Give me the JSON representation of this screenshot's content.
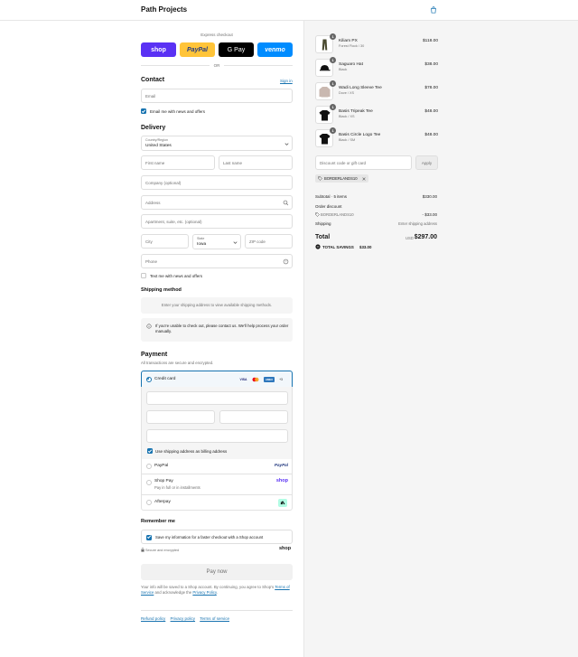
{
  "header": {
    "brand": "Path Projects",
    "cart_icon": "shopping-bag-icon"
  },
  "express": {
    "label": "Express checkout",
    "buttons": [
      {
        "label": "shop",
        "color": "#5a31f4"
      },
      {
        "label": "PayPal",
        "color": "#ffc439"
      },
      {
        "label": "G Pay",
        "color": "#000000"
      },
      {
        "label": "venmo",
        "color": "#008cff"
      }
    ],
    "or": "OR"
  },
  "contact": {
    "title": "Contact",
    "sign_in": "Sign in",
    "email_placeholder": "Email",
    "newsletter_label": "Email me with news and offers",
    "newsletter_checked": true
  },
  "delivery": {
    "title": "Delivery",
    "country_label": "Country/Region",
    "country_value": "United States",
    "first_name": "First name",
    "last_name": "Last name",
    "company": "Company (optional)",
    "address": "Address",
    "apartment": "Apartment, suite, etc. (optional)",
    "city": "City",
    "state_label": "State",
    "state_value": "Iowa",
    "zip": "ZIP code",
    "phone": "Phone",
    "text_label": "Text me with news and offers",
    "text_checked": false
  },
  "shipping": {
    "title": "Shipping method",
    "placeholder": "Enter your shipping address to view available shipping methods.",
    "notice": "If you're unable to check out, please contact us. We'll help process your order manually."
  },
  "payment": {
    "title": "Payment",
    "subtitle": "All transactions are secure and encrypted.",
    "credit_card_label": "Credit card",
    "card_brands": [
      "VISA",
      "MC",
      "AMEX",
      "+3"
    ],
    "billing_label": "Use shipping address as billing address",
    "billing_checked": true,
    "options": [
      {
        "label": "PayPal",
        "sub": "",
        "badge": "PayPal"
      },
      {
        "label": "Shop Pay",
        "sub": "Pay in full or in installments",
        "badge": "shop"
      },
      {
        "label": "Afterpay",
        "sub": "",
        "badge": "afterpay"
      }
    ],
    "accent": "#1773b0"
  },
  "remember": {
    "title": "Remember me",
    "save_label": "Save my information for a faster checkout with a Shop account",
    "save_checked": true,
    "secure": "Secure and encrypted",
    "shop_logo": "shop"
  },
  "pay_now": "Pay now",
  "legal": {
    "text_before": "Your info will be saved to a Shop account. By continuing, you agree to Shop's ",
    "terms": "Terms of Service",
    "middle": " and acknowledge the ",
    "privacy": "Privacy Policy",
    "end": "."
  },
  "footer": [
    "Refund policy",
    "Privacy policy",
    "Terms of service"
  ],
  "cart": {
    "items": [
      {
        "name": "Kiliam PX",
        "variant": "Forest Flock / 30",
        "price": "$118.00",
        "qty": "1",
        "kind": "pants"
      },
      {
        "name": "Saguaro Hat",
        "variant": "Black",
        "price": "$38.00",
        "qty": "1",
        "kind": "hat"
      },
      {
        "name": "Wadi Long Sleeve Tee",
        "variant": "Dove / XS",
        "price": "$78.00",
        "qty": "1",
        "kind": "longsleeve"
      },
      {
        "name": "Basis Tripeak Tee",
        "variant": "Black / XS",
        "price": "$48.00",
        "qty": "1",
        "kind": "tee"
      },
      {
        "name": "Basis Circle Logo Tee",
        "variant": "Black / SM",
        "price": "$48.00",
        "qty": "1",
        "kind": "tee"
      }
    ],
    "discount_placeholder": "Discount code or gift card",
    "apply": "Apply",
    "code": "BORDERLANDS10",
    "subtotal_label": "Subtotal · 5 items",
    "subtotal": "$330.00",
    "order_discount_label": "Order discount",
    "order_discount_code": "BORDERLANDS10",
    "order_discount": "- $33.00",
    "shipping_label": "Shipping",
    "shipping_value": "Enter shipping address",
    "total_label": "Total",
    "currency": "USD",
    "total": "$297.00",
    "savings_label": "TOTAL SAVINGS",
    "savings": "$33.00"
  }
}
